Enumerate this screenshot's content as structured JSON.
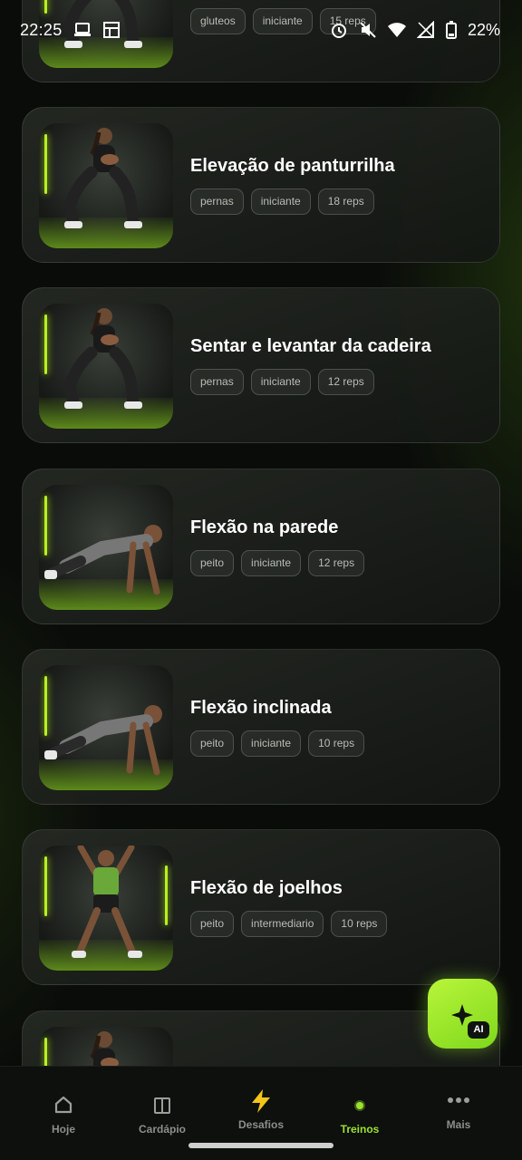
{
  "status_bar": {
    "time": "22:25",
    "battery": "22%",
    "icons": [
      "laptop-icon",
      "window-icon",
      "alarm-icon",
      "mute-icon",
      "wifi-icon",
      "signal-icon",
      "battery-icon"
    ]
  },
  "exercises": [
    {
      "title": "",
      "tags": [
        "gluteos",
        "iniciante",
        "15 reps"
      ],
      "image": "squat-woman"
    },
    {
      "title": "Elevação de panturrilha",
      "tags": [
        "pernas",
        "iniciante",
        "18 reps"
      ],
      "image": "squat-woman"
    },
    {
      "title": "Sentar e levantar da cadeira",
      "tags": [
        "pernas",
        "iniciante",
        "12 reps"
      ],
      "image": "squat-woman"
    },
    {
      "title": "Flexão na parede",
      "tags": [
        "peito",
        "iniciante",
        "12 reps"
      ],
      "image": "pushup-man"
    },
    {
      "title": "Flexão inclinada",
      "tags": [
        "peito",
        "iniciante",
        "10 reps"
      ],
      "image": "pushup-man"
    },
    {
      "title": "Flexão de joelhos",
      "tags": [
        "peito",
        "intermediario",
        "10 reps"
      ],
      "image": "jumping-man"
    },
    {
      "title": "",
      "tags": [],
      "image": "squat-woman"
    }
  ],
  "fab": {
    "badge": "AI",
    "icon": "sparkle-icon"
  },
  "nav": {
    "items": [
      {
        "label": "Hoje",
        "icon": "home-icon"
      },
      {
        "label": "Cardápio",
        "icon": "book-icon"
      },
      {
        "label": "Desafios",
        "icon": "lightning-icon"
      },
      {
        "label": "Treinos",
        "icon": "dot-icon",
        "active": true
      },
      {
        "label": "Mais",
        "icon": "more-icon"
      }
    ]
  },
  "colors": {
    "accent": "#9be22e",
    "background": "#0a0c0a",
    "card": "#1c1f1b"
  }
}
